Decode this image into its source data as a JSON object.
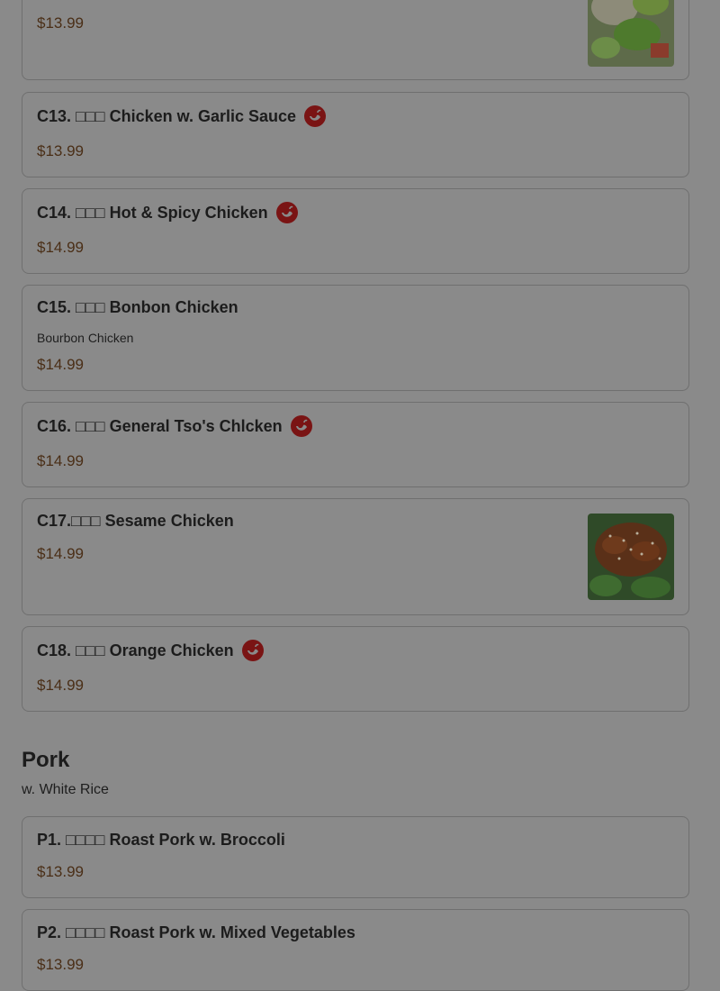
{
  "chicken_items": [
    {
      "name": "",
      "price": "$13.99"
    },
    {
      "name": "C13. □□□ Chicken w. Garlic Sauce",
      "price": "$13.99"
    },
    {
      "name": "C14. □□□ Hot & Spicy Chicken",
      "price": "$14.99"
    },
    {
      "name": "C15. □□□ Bonbon Chicken",
      "description": "Bourbon Chicken",
      "price": "$14.99"
    },
    {
      "name": "C16. □□□ General Tso's Chlcken",
      "price": "$14.99"
    },
    {
      "name": "C17.□□□ Sesame Chicken",
      "price": "$14.99"
    },
    {
      "name": "C18. □□□ Orange Chicken",
      "price": "$14.99"
    }
  ],
  "pork_section": {
    "title": "Pork",
    "subtitle": "w. White Rice"
  },
  "pork_items": [
    {
      "name": "P1. □□□□ Roast Pork w. Broccoli",
      "price": "$13.99"
    },
    {
      "name": "P2. □□□□ Roast Pork w. Mixed Vegetables",
      "price": "$13.99"
    }
  ],
  "icons": {
    "spicy": "chili-pepper-icon"
  },
  "colors": {
    "overlay_bg": "#8a8a8a",
    "price_text": "#4a2e16",
    "spicy_badge": "#7a1414"
  }
}
